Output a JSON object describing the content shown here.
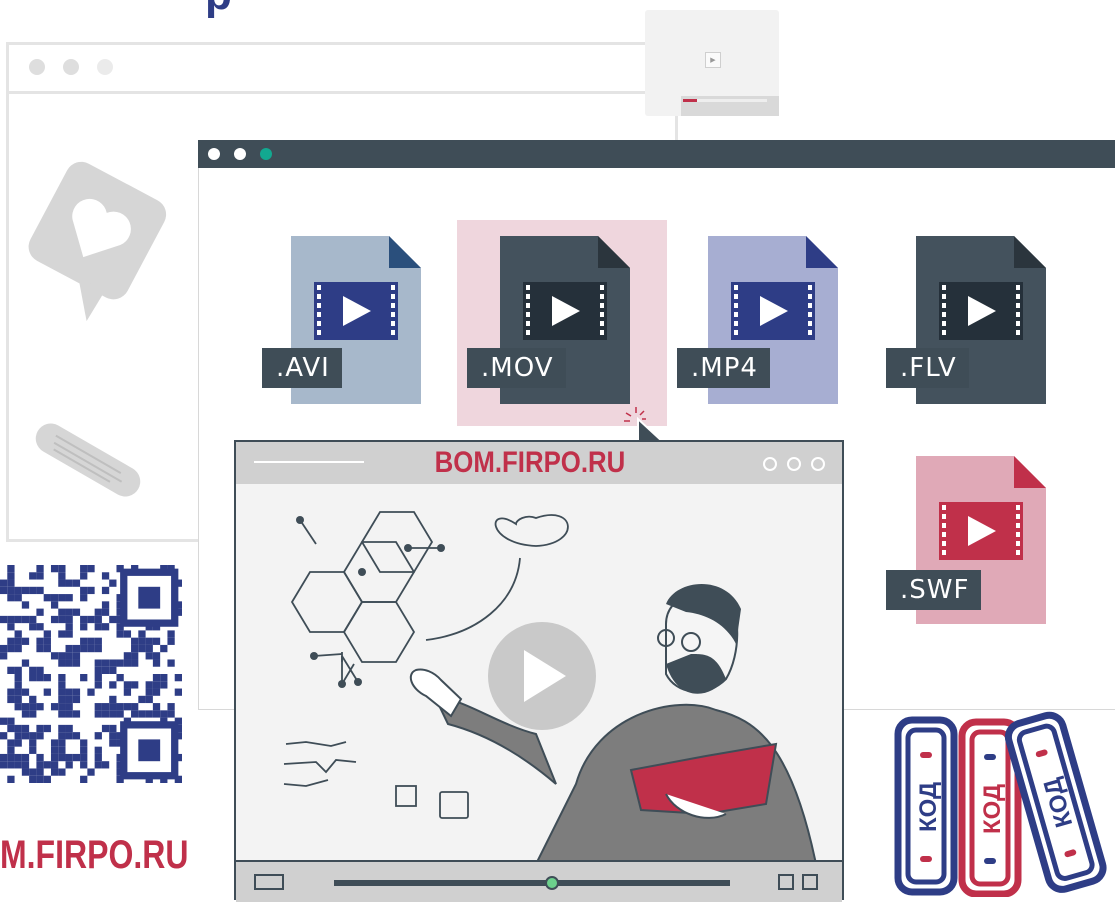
{
  "top_partial_text": "p",
  "player": {
    "url": "BOM.FIRPO.RU"
  },
  "files": [
    {
      "label": ".AVI",
      "color": "#a7b8cb",
      "fold": "#2a4f7c",
      "frame": "#2e3d86"
    },
    {
      "label": ".MOV",
      "color": "#44525d",
      "fold": "#2b353d",
      "frame": "#25303a",
      "selected": true
    },
    {
      "label": ".MP4",
      "color": "#a7aed2",
      "fold": "#2e3d86",
      "frame": "#2e3d86"
    },
    {
      "label": ".FLV",
      "color": "#44525d",
      "fold": "#2b353d",
      "frame": "#25303a"
    },
    {
      "label": ".SWF",
      "color": "#e0a9b7",
      "fold": "#c0304a",
      "frame": "#c0304a"
    }
  ],
  "bottom_url": "M.FIRPO.RU",
  "books": [
    {
      "label": "КОД",
      "color": "#2e3d86"
    },
    {
      "label": "КОД",
      "color": "#c0304a"
    },
    {
      "label": "КОД",
      "color": "#2e3d86"
    }
  ],
  "colors": {
    "accent_red": "#c0304a",
    "navy": "#2e3d86",
    "slate": "#3f4d57"
  }
}
